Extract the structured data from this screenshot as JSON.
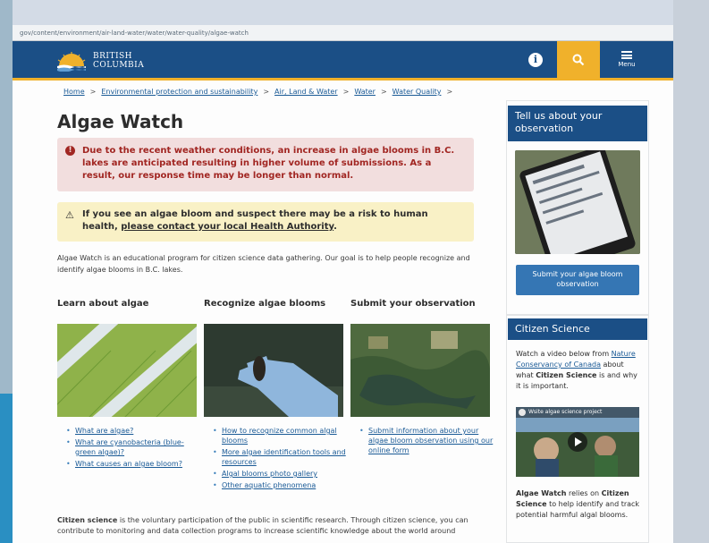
{
  "url": "gov/content/environment/air-land-water/water/water-quality/algae-watch",
  "header": {
    "brand_line1": "BRITISH",
    "brand_line2": "COLUMBIA",
    "menu_label": "Menu",
    "icons": {
      "info": "info-icon",
      "search": "search-icon",
      "menu": "hamburger-icon"
    },
    "colors": {
      "primary": "#1b4f86",
      "accent": "#f0b12b"
    }
  },
  "breadcrumb": [
    {
      "label": "Home"
    },
    {
      "label": "Environmental protection and sustainability"
    },
    {
      "label": "Air, Land & Water"
    },
    {
      "label": "Water"
    },
    {
      "label": "Water Quality"
    }
  ],
  "breadcrumb_separator": ">",
  "page": {
    "title": "Algae Watch",
    "alert_danger": "Due to the recent weather conditions, an increase in algae blooms in B.C. lakes are anticipated resulting in higher volume of submissions. As a result, our response time may be longer than normal.",
    "alert_warning_text": "If you see an algae bloom and suspect there may be a risk to human health, ",
    "alert_warning_link": "please contact your local Health Authority",
    "alert_warning_end": ".",
    "intro": "Algae Watch is an educational program for citizen science data gathering. Our goal is to help people recognize and identify algae blooms in B.C. lakes.",
    "columns": [
      {
        "heading": "Learn about algae",
        "links": [
          "What are algae?",
          "What are cyanobacteria (blue-green algae)?",
          "What causes an algae bloom?"
        ]
      },
      {
        "heading": "Recognize algae blooms",
        "links": [
          "How to recognize common algal blooms",
          "More algae identification tools and resources",
          "Algal blooms photo gallery",
          "Other aquatic phenomena"
        ]
      },
      {
        "heading": "Submit your observation",
        "links": [
          "Submit information about your algae bloom observation using our online form"
        ]
      }
    ],
    "citizen_bold": "Citizen science",
    "citizen_text": " is the voluntary participation of the public in scientific research. Through citizen science, you can contribute to monitoring and data collection programs to increase scientific knowledge about the world around"
  },
  "sidebar": {
    "box1_title": "Tell us about your observation",
    "box1_button": "Submit your algae bloom observation",
    "box2_title": "Citizen Science",
    "box2_text_pre": "Watch a video below from ",
    "box2_link": "Nature Conservancy of Canada",
    "box2_text_mid": " about what ",
    "box2_bold": "Citizen Science",
    "box2_text_end": " is and why it is important.",
    "video_title": "Wsite algae science project",
    "box2_footer_bold1": "Algae Watch",
    "box2_footer_mid": " relies on ",
    "box2_footer_bold2": "Citizen Science",
    "box2_footer_end": " to help identify and track potential harmful algal blooms."
  }
}
